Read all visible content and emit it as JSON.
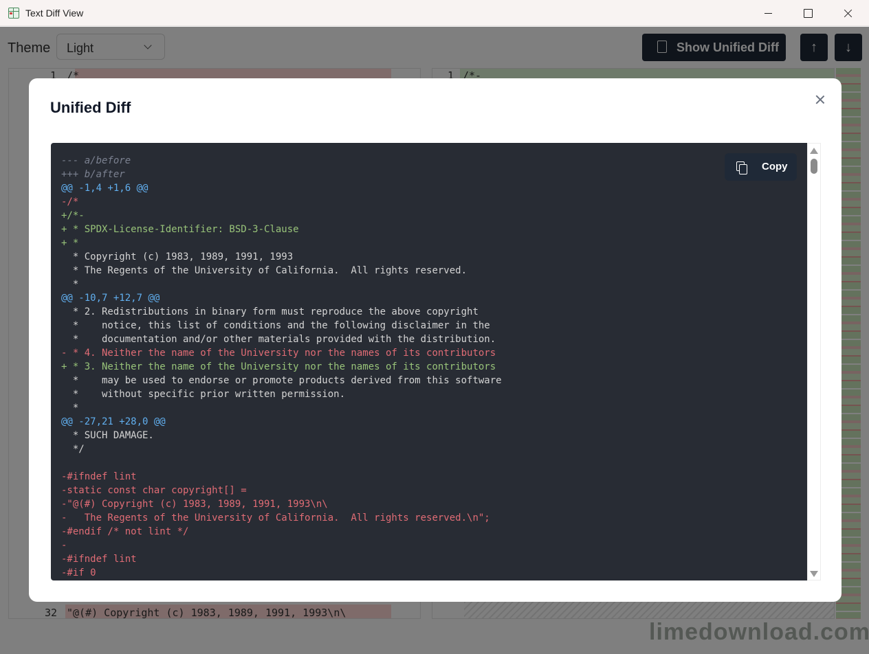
{
  "window": {
    "title": "Text Diff View"
  },
  "toolbar": {
    "theme_label": "Theme",
    "theme_value": "Light",
    "unified_button": "Show Unified Diff",
    "up_arrow": "↑",
    "down_arrow": "↓"
  },
  "editor": {
    "left_top_line_number": "1",
    "left_top_text": "/*",
    "right_top_line_number": "1",
    "right_top_text": "/*-",
    "left_bottom_line_number": "32",
    "left_bottom_text": "\"@(#) Copyright (c) 1983, 1989, 1991, 1993\\n\\"
  },
  "watermark": "limedownload.com",
  "modal": {
    "title": "Unified Diff",
    "copy_label": "Copy",
    "lines": [
      {
        "type": "meta",
        "text": "--- a/before"
      },
      {
        "type": "meta",
        "text": "+++ b/after"
      },
      {
        "type": "hunk",
        "text": "@@ -1,4 +1,6 @@"
      },
      {
        "type": "del",
        "text": "-/*"
      },
      {
        "type": "add",
        "text": "+/*-"
      },
      {
        "type": "add",
        "text": "+ * SPDX-License-Identifier: BSD-3-Clause"
      },
      {
        "type": "add",
        "text": "+ *"
      },
      {
        "type": "ctx",
        "text": "  * Copyright (c) 1983, 1989, 1991, 1993"
      },
      {
        "type": "ctx",
        "text": "  * The Regents of the University of California.  All rights reserved."
      },
      {
        "type": "ctx",
        "text": "  *"
      },
      {
        "type": "hunk",
        "text": "@@ -10,7 +12,7 @@"
      },
      {
        "type": "ctx",
        "text": "  * 2. Redistributions in binary form must reproduce the above copyright"
      },
      {
        "type": "ctx",
        "text": "  *    notice, this list of conditions and the following disclaimer in the"
      },
      {
        "type": "ctx",
        "text": "  *    documentation and/or other materials provided with the distribution."
      },
      {
        "type": "del",
        "text": "- * 4. Neither the name of the University nor the names of its contributors"
      },
      {
        "type": "add",
        "text": "+ * 3. Neither the name of the University nor the names of its contributors"
      },
      {
        "type": "ctx",
        "text": "  *    may be used to endorse or promote products derived from this software"
      },
      {
        "type": "ctx",
        "text": "  *    without specific prior written permission."
      },
      {
        "type": "ctx",
        "text": "  *"
      },
      {
        "type": "hunk",
        "text": "@@ -27,21 +28,0 @@"
      },
      {
        "type": "ctx",
        "text": "  * SUCH DAMAGE."
      },
      {
        "type": "ctx",
        "text": "  */"
      },
      {
        "type": "ctx",
        "text": " "
      },
      {
        "type": "del",
        "text": "-#ifndef lint"
      },
      {
        "type": "del",
        "text": "-static const char copyright[] ="
      },
      {
        "type": "del",
        "text": "-\"@(#) Copyright (c) 1983, 1989, 1991, 1993\\n\\"
      },
      {
        "type": "del",
        "text": "-   The Regents of the University of California.  All rights reserved.\\n\";"
      },
      {
        "type": "del",
        "text": "-#endif /* not lint */"
      },
      {
        "type": "del",
        "text": "-"
      },
      {
        "type": "del",
        "text": "-#ifndef lint"
      },
      {
        "type": "del",
        "text": "-#if 0"
      }
    ]
  }
}
